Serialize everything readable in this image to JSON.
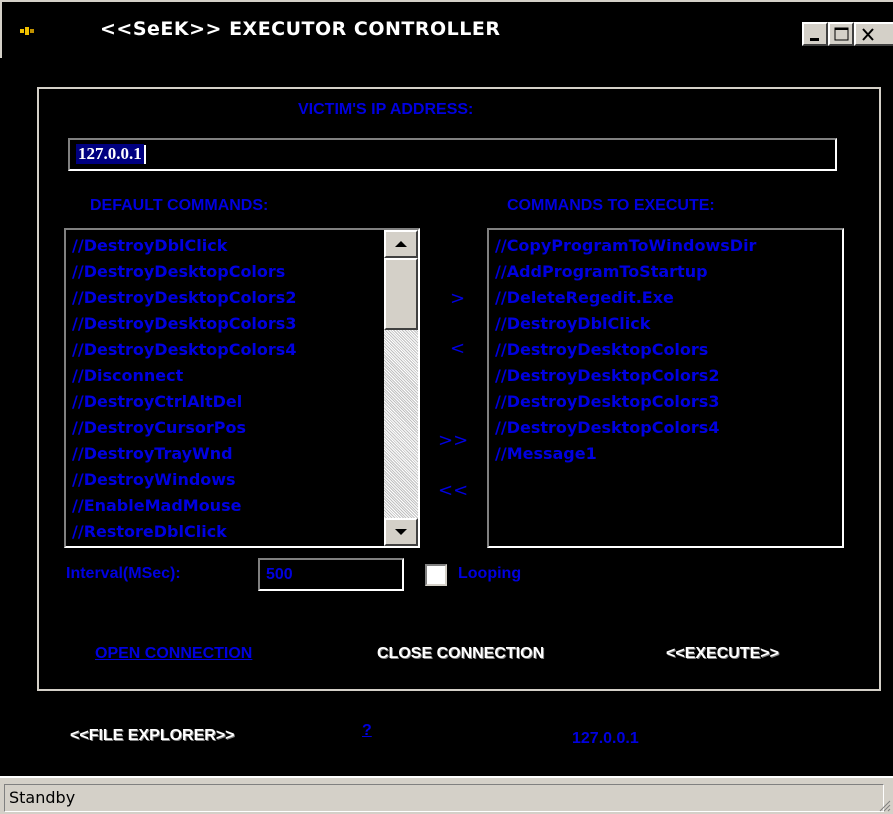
{
  "window": {
    "title": "<<SeEK>> EXECUTOR CONTROLLER",
    "icon": "app-icon"
  },
  "ip_section": {
    "label": "VICTIM'S IP ADDRESS:",
    "value": "127.0.0.1"
  },
  "default_commands": {
    "label": "DEFAULT COMMANDS:",
    "items": [
      "//DestroyDblClick",
      "//DestroyDesktopColors",
      "//DestroyDesktopColors2",
      "//DestroyDesktopColors3",
      "//DestroyDesktopColors4",
      "//Disconnect",
      "//DestroyCtrlAltDel",
      "//DestroyCursorPos",
      "//DestroyTrayWnd",
      "//DestroyWindows",
      "//EnableMadMouse",
      "//RestoreDblClick"
    ]
  },
  "execute_commands": {
    "label": "COMMANDS TO EXECUTE:",
    "items": [
      "//CopyProgramToWindowsDir",
      "//AddProgramToStartup",
      "//DeleteRegedit.Exe",
      "//DestroyDblClick",
      "//DestroyDesktopColors",
      "//DestroyDesktopColors2",
      "//DestroyDesktopColors3",
      "//DestroyDesktopColors4",
      "//Message1"
    ]
  },
  "transfer_buttons": {
    "add_one": ">",
    "remove_one": "<",
    "add_all": ">>",
    "remove_all": "<<"
  },
  "options": {
    "interval_label": "Interval(MSec):",
    "interval_value": "500",
    "looping_label": "Looping",
    "looping_checked": false
  },
  "actions": {
    "open_connection": "OPEN CONNECTION",
    "close_connection": "CLOSE CONNECTION",
    "execute": "<<EXECUTE>>"
  },
  "footer": {
    "file_explorer": "<<FILE EXPLORER>>",
    "help": "?",
    "ip_display": "127.0.0.1"
  },
  "statusbar": {
    "text": "Standby"
  },
  "colors": {
    "background": "#000000",
    "accent_blue": "#0000e0",
    "chrome": "#d4d0c8"
  }
}
